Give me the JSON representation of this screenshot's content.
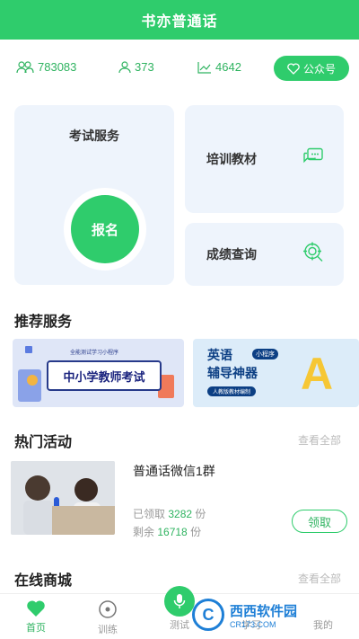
{
  "header": {
    "title": "书亦普通话"
  },
  "stats": {
    "users": "783083",
    "people": "373",
    "trend": "4642",
    "gzh_label": "公众号"
  },
  "services": {
    "exam_label": "考试服务",
    "signup_label": "报名",
    "training_label": "培训教材",
    "score_label": "成绩查询"
  },
  "recommended": {
    "title": "推荐服务",
    "banner1": {
      "tag": "全能测试学习小程序",
      "text": "中小学教师考试"
    },
    "banner2": {
      "title_line1": "英语",
      "title_line2": "辅导神器",
      "tag": "小程序",
      "sub": "人教版教材编制",
      "letter": "A"
    }
  },
  "hot": {
    "title": "热门活动",
    "view_all": "查看全部",
    "activity": {
      "name": "普通话微信1群",
      "claimed_prefix": "已领取",
      "claimed": "3282",
      "remaining_prefix": "剩余",
      "remaining": "16718",
      "unit": "份",
      "claim_label": "领取"
    }
  },
  "mall": {
    "title": "在线商城",
    "view_all": "查看全部"
  },
  "tabs": [
    {
      "label": "首页"
    },
    {
      "label": "训练"
    },
    {
      "label": "测试"
    },
    {
      "label": "学习"
    },
    {
      "label": "我的"
    }
  ],
  "watermark": {
    "main": "西西软件园",
    "url": "CR173.COM",
    "logo": "C"
  },
  "colors": {
    "brand": "#2fcc6c",
    "card_bg": "#eef4fc"
  }
}
